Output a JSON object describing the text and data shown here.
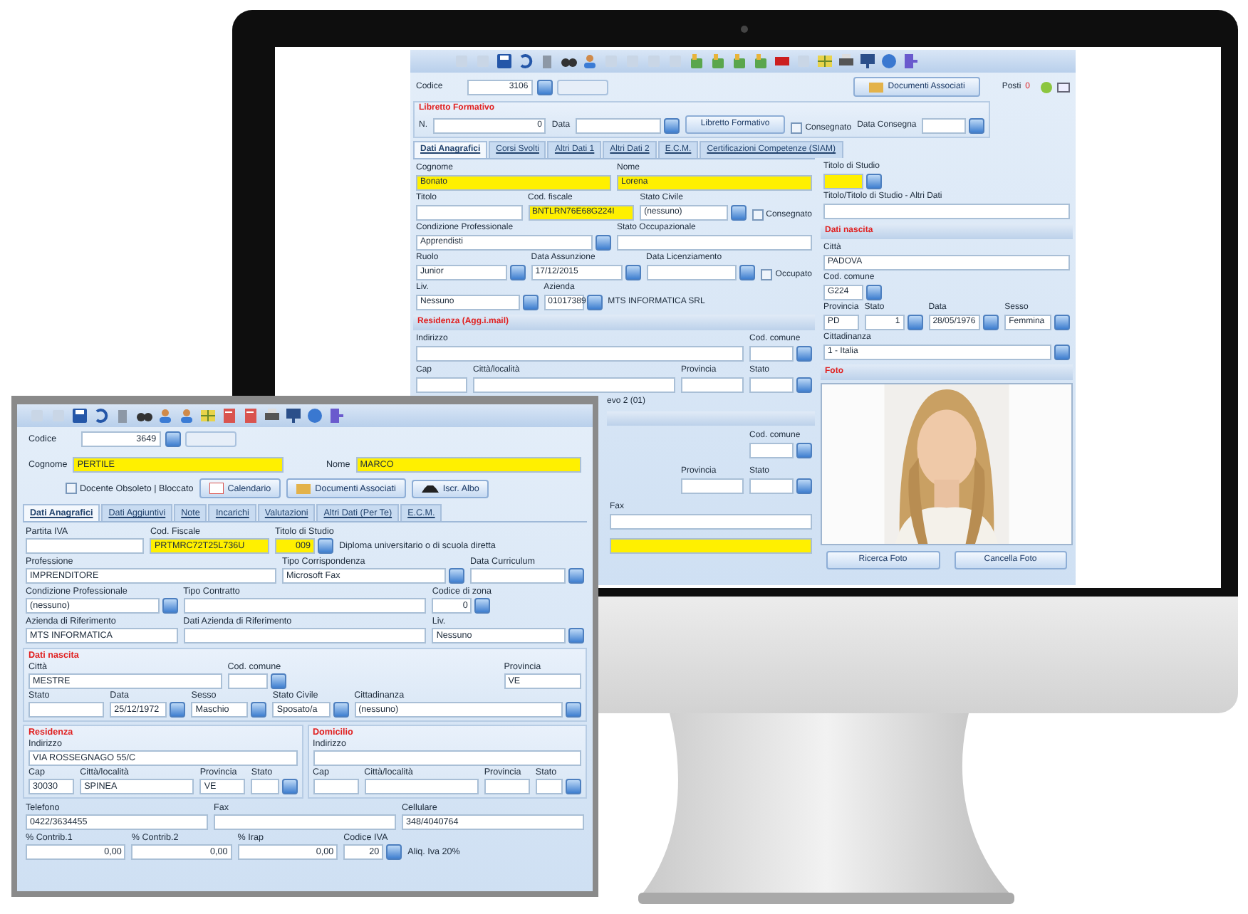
{
  "back_window": {
    "header": {
      "codice_label": "Codice",
      "codice_value": "3106",
      "documents_button": "Documenti Associati",
      "posti_label": "Posti",
      "posti_value": "0"
    },
    "libretto": {
      "title": "Libretto Formativo",
      "fields": [
        {
          "kind": "number",
          "label": "N.",
          "value": "0"
        },
        {
          "kind": "date",
          "label": "Data"
        },
        {
          "kind": "button",
          "value": "Libretto Formativo"
        },
        {
          "kind": "check",
          "value": "Consegnato",
          "checked": false
        },
        {
          "kind": "date",
          "label": "Data Consegna"
        }
      ]
    },
    "tabs": [
      {
        "label": "Dati Anagrafici",
        "selected": true
      },
      {
        "label": "Corsi Svolti",
        "selected": false
      },
      {
        "label": "Altri Dati 1",
        "selected": false
      },
      {
        "label": "Altri Dati 2",
        "selected": false
      },
      {
        "label": "E.C.M.",
        "selected": false
      },
      {
        "label": "Certificazioni Competenze (SIAM)",
        "selected": false
      }
    ],
    "left_rows": [
      [
        {
          "kind": "required",
          "label": "Cognome",
          "value": "Bonato"
        },
        {
          "kind": "required",
          "label": "Nome",
          "value": "Lorena"
        }
      ],
      [
        {
          "kind": "text",
          "label": "Titolo"
        },
        {
          "kind": "required",
          "label": "Cod. fiscale",
          "value": "BNTLRN76E68G224I"
        },
        {
          "kind": "combo",
          "label": "Stato Civile",
          "value": "(nessuno)"
        },
        {
          "kind": "check",
          "value": "Consegnato",
          "checked": false
        }
      ],
      [
        {
          "kind": "combo",
          "label": "Condizione Professionale",
          "value": "Apprendisti"
        },
        {
          "kind": "text",
          "label": "Stato Occupazionale"
        }
      ],
      [
        {
          "kind": "combo",
          "label": "Ruolo",
          "value": "Junior"
        },
        {
          "kind": "date",
          "label": "Data Assunzione",
          "value": "17/12/2015"
        },
        {
          "kind": "date",
          "label": "Data Licenziamento"
        },
        {
          "kind": "check",
          "value": "Occupato",
          "checked": false
        }
      ],
      [
        {
          "kind": "combo",
          "label": "Liv.",
          "value": "Nessuno"
        },
        {
          "kind": "lookup",
          "label": "Azienda",
          "value": "01017389",
          "desc": "MTS INFORMATICA SRL"
        }
      ]
    ],
    "residenza": {
      "title": "Residenza (Agg.i.mail)",
      "fields": [
        {
          "kind": "text",
          "label": "Indirizzo"
        },
        {
          "kind": "combo",
          "label": "Cod. comune"
        },
        {
          "kind": "text",
          "label": "Cap"
        },
        {
          "kind": "text",
          "label": "Città/località"
        },
        {
          "kind": "text",
          "label": "Provincia"
        },
        {
          "kind": "combo",
          "label": "Stato"
        }
      ]
    },
    "covered": {
      "note": "evo 2 (01)",
      "fields": [
        {
          "kind": "combo",
          "label": "Cod. comune"
        },
        {
          "kind": "text",
          "label": "Provincia"
        },
        {
          "kind": "combo",
          "label": "Stato"
        },
        {
          "kind": "text",
          "label": "Fax"
        },
        {
          "kind": "required"
        }
      ]
    },
    "right_rows": [
      [
        {
          "kind": "lookup_required",
          "label": "Titolo di Studio"
        }
      ],
      [
        {
          "kind": "text",
          "label": "Titolo/Titolo di Studio - Altri Dati"
        }
      ]
    ],
    "nascita": {
      "title": "Dati nascita",
      "rows": [
        [
          {
            "kind": "text",
            "label": "Città",
            "value": "PADOVA"
          }
        ],
        [
          {
            "kind": "lookup",
            "label": "Cod. comune",
            "value": "G224"
          }
        ],
        [
          {
            "kind": "text",
            "label": "Provincia",
            "value": "PD"
          },
          {
            "kind": "lookup",
            "label": "Stato",
            "value": "1"
          },
          {
            "kind": "date",
            "label": "Data",
            "value": "28/05/1976"
          },
          {
            "kind": "combo",
            "label": "Sesso",
            "value": "Femmina"
          }
        ],
        [
          {
            "kind": "combo",
            "label": "Cittadinanza",
            "value": "1 - Italia"
          }
        ]
      ]
    },
    "foto": {
      "title": "Foto",
      "picture": {
        "kind": "picture"
      },
      "buttons": [
        "Ricerca Foto",
        "Cancella Foto"
      ]
    }
  },
  "front_window": {
    "header": {
      "codice_label": "Codice",
      "codice_value": "3649"
    },
    "name_row": [
      {
        "kind": "required",
        "label": "Cognome",
        "value": "PERTILE"
      },
      {
        "kind": "required",
        "label": "Nome",
        "value": "MARCO"
      }
    ],
    "options": [
      {
        "kind": "check",
        "value": "Docente Obsoleto | Bloccato",
        "checked": false
      },
      {
        "kind": "button",
        "value": "Calendario"
      },
      {
        "kind": "button",
        "value": "Documenti Associati"
      },
      {
        "kind": "button",
        "value": "Iscr. Albo"
      }
    ],
    "tabs": [
      {
        "label": "Dati Anagrafici",
        "selected": true
      },
      {
        "label": "Dati Aggiuntivi",
        "selected": false
      },
      {
        "label": "Note",
        "selected": false
      },
      {
        "label": "Incarichi",
        "selected": false
      },
      {
        "label": "Valutazioni",
        "selected": false
      },
      {
        "label": "Altri Dati (Per Te)",
        "selected": false
      },
      {
        "label": "E.C.M.",
        "selected": false
      }
    ],
    "rows": [
      [
        {
          "kind": "text",
          "label": "Partita IVA"
        },
        {
          "kind": "required",
          "label": "Cod. Fiscale",
          "value": "PRTMRC72T25L736U"
        },
        {
          "kind": "lookup_required",
          "label": "Titolo di Studio",
          "value": "009",
          "desc": "Diploma universitario o di scuola diretta"
        }
      ],
      [
        {
          "kind": "text",
          "label": "Professione",
          "value": "IMPRENDITORE"
        },
        {
          "kind": "combo",
          "label": "Tipo Corrispondenza",
          "value": "Microsoft Fax"
        },
        {
          "kind": "date",
          "label": "Data Curriculum"
        }
      ],
      [
        {
          "kind": "combo",
          "label": "Condizione Professionale",
          "value": "(nessuno)"
        },
        {
          "kind": "text",
          "label": "Tipo Contratto"
        },
        {
          "kind": "lookup",
          "label": "Codice di zona",
          "value": "0"
        }
      ],
      [
        {
          "kind": "text",
          "label": "Azienda di Riferimento",
          "value": "MTS INFORMATICA"
        },
        {
          "kind": "text",
          "label": "Dati Azienda di Riferimento"
        },
        {
          "kind": "combo",
          "label": "Liv.",
          "value": "Nessuno"
        }
      ]
    ],
    "nascita": {
      "title": "Dati nascita",
      "rows": [
        [
          {
            "kind": "text",
            "label": "Città",
            "value": "MESTRE"
          },
          {
            "kind": "lookup",
            "label": "Cod. comune"
          },
          {
            "kind": "text",
            "label": "Provincia",
            "value": "VE"
          }
        ],
        [
          {
            "kind": "text",
            "label": "Stato"
          },
          {
            "kind": "date",
            "label": "Data",
            "value": "25/12/1972"
          },
          {
            "kind": "combo",
            "label": "Sesso",
            "value": "Maschio"
          },
          {
            "kind": "combo",
            "label": "Stato Civile",
            "value": "Sposato/a"
          },
          {
            "kind": "combo",
            "label": "Cittadinanza",
            "value": "(nessuno)"
          }
        ]
      ]
    },
    "residenza": {
      "title": "Residenza",
      "rows": [
        [
          {
            "kind": "text",
            "label": "Indirizzo",
            "value": "VIA ROSSEGNAGO 55/C"
          }
        ],
        [
          {
            "kind": "text",
            "label": "Cap",
            "value": "30030"
          },
          {
            "kind": "text",
            "label": "Città/località",
            "value": "SPINEA"
          },
          {
            "kind": "text",
            "label": "Provincia",
            "value": "VE"
          },
          {
            "kind": "combo",
            "label": "Stato"
          }
        ]
      ]
    },
    "domicilio": {
      "title": "Domicilio",
      "rows": [
        [
          {
            "kind": "text",
            "label": "Indirizzo"
          }
        ],
        [
          {
            "kind": "text",
            "label": "Cap"
          },
          {
            "kind": "text",
            "label": "Città/località"
          },
          {
            "kind": "text",
            "label": "Provincia"
          },
          {
            "kind": "combo",
            "label": "Stato"
          }
        ]
      ]
    },
    "contact_rows": [
      [
        {
          "kind": "text",
          "label": "Telefono",
          "value": "0422/3634455"
        },
        {
          "kind": "text",
          "label": "Fax"
        },
        {
          "kind": "text",
          "label": "Cellulare",
          "value": "348/4040764"
        }
      ],
      [
        {
          "kind": "number",
          "label": "% Contrib.1",
          "value": "0,00"
        },
        {
          "kind": "number",
          "label": "% Contrib.2",
          "value": "0,00"
        },
        {
          "kind": "number",
          "label": "% Irap",
          "value": "0,00"
        },
        {
          "kind": "lookup",
          "label": "Codice IVA",
          "value": "20",
          "desc": "Aliq. Iva 20%"
        }
      ]
    ]
  }
}
